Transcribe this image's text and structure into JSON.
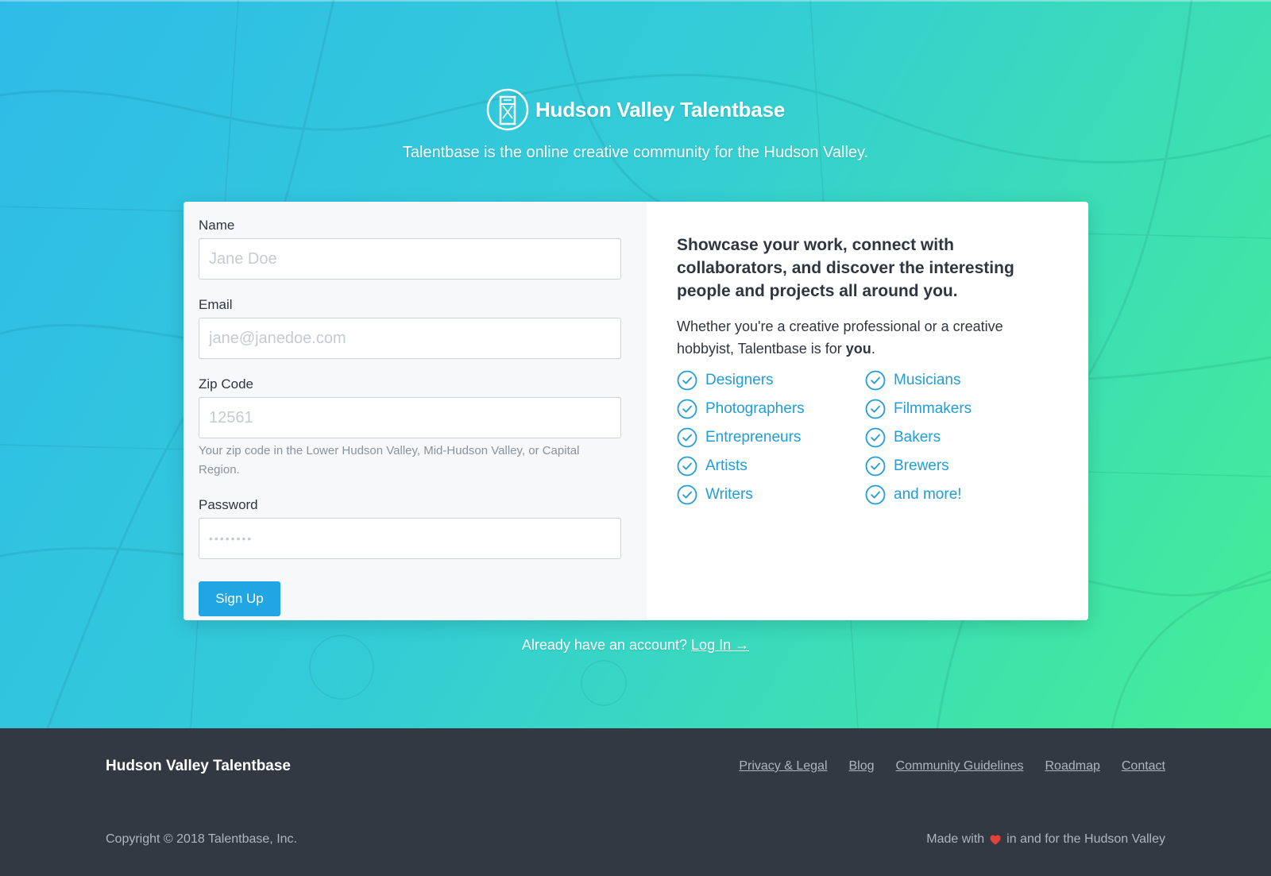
{
  "hero": {
    "brand_name": "Hudson Valley Talentbase",
    "tagline": "Talentbase is the online creative community for the Hudson Valley."
  },
  "form": {
    "name_label": "Name",
    "name_placeholder": "Jane Doe",
    "email_label": "Email",
    "email_placeholder": "jane@janedoe.com",
    "zip_label": "Zip Code",
    "zip_placeholder": "12561",
    "zip_help": "Your zip code in the Lower Hudson Valley, Mid-Hudson Valley, or Capital Region.",
    "password_label": "Password",
    "password_placeholder": "••••••••",
    "signup_label": "Sign Up"
  },
  "info": {
    "heading": "Showcase your work, connect with collaborators, and discover the interesting people and projects all around you.",
    "text_before": "Whether you're a creative professional or a creative hobbyist, Talentbase is for ",
    "text_bold": "you",
    "text_after": ".",
    "items": [
      "Designers",
      "Musicians",
      "Photographers",
      "Filmmakers",
      "Entrepreneurs",
      "Bakers",
      "Artists",
      "Brewers",
      "Writers",
      "and more!"
    ]
  },
  "login": {
    "prompt": "Already have an account? ",
    "link_label": "Log In →"
  },
  "footer": {
    "brand": "Hudson Valley Talentbase",
    "links": [
      "Privacy & Legal",
      "Blog",
      "Community Guidelines",
      "Roadmap",
      "Contact"
    ],
    "copyright": "Copyright © 2018 Talentbase, Inc.",
    "made_before": "Made with",
    "made_after": "in and for the Hudson Valley"
  },
  "colors": {
    "accent": "#22a6e3",
    "check": "#229dd8",
    "footer_bg": "#323943",
    "heart": "#e5403a"
  },
  "icons": {
    "logo": "bridge-logo-icon",
    "check": "check-circle-icon",
    "heart": "heart-icon"
  }
}
